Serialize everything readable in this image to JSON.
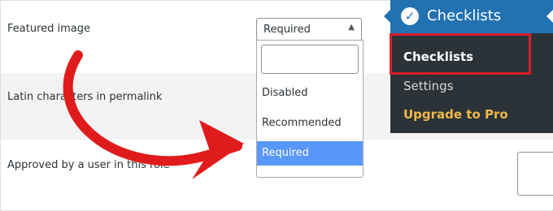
{
  "rows": [
    {
      "label": "Featured image"
    },
    {
      "label": "Latin characters in permalink"
    },
    {
      "label": "Approved by a user in this role"
    }
  ],
  "select": {
    "value": "Required",
    "caret": "▲",
    "options": [
      "Disabled",
      "Recommended",
      "Required"
    ],
    "selected": "Required"
  },
  "menu": {
    "title": "Checklists",
    "icon": "checkmark-circle-icon",
    "items": [
      {
        "label": "Checklists",
        "current": true
      },
      {
        "label": "Settings"
      },
      {
        "label": "Upgrade to Pro",
        "color": "#f0b849"
      }
    ]
  },
  "colors": {
    "menu_bg": "#2c3338",
    "menu_header": "#2271b1",
    "option_selected": "#5897fb",
    "annotation_red": "#e01b1b"
  }
}
